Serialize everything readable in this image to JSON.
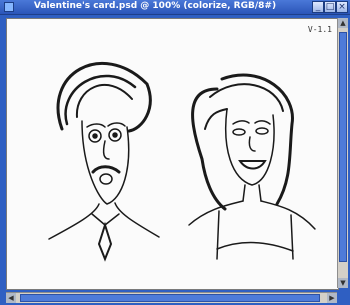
{
  "window": {
    "title": "Valentine's card.psd @ 100% (colorize, RGB/8#)",
    "buttons": [
      "minimize",
      "maximize",
      "close"
    ]
  },
  "canvas": {
    "badge": "V-1.1",
    "content": {
      "man": "sketched man face with surprised expression, big hair and mustache",
      "woman": "sketched woman face with curly hair and open-mouth smile"
    }
  },
  "scrollbars": {
    "vertical_position": 0.0,
    "horizontal_position": 0.0
  }
}
